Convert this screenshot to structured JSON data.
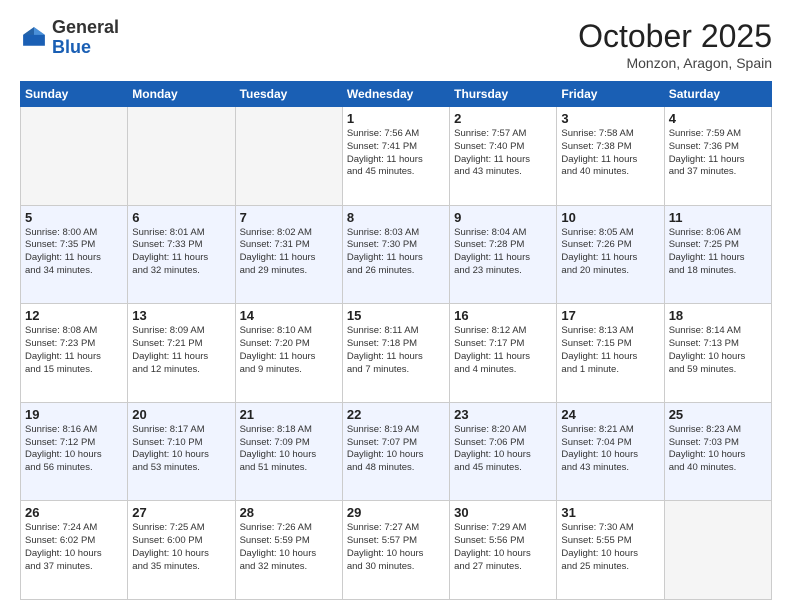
{
  "header": {
    "logo_general": "General",
    "logo_blue": "Blue",
    "month_title": "October 2025",
    "location": "Monzon, Aragon, Spain"
  },
  "weekdays": [
    "Sunday",
    "Monday",
    "Tuesday",
    "Wednesday",
    "Thursday",
    "Friday",
    "Saturday"
  ],
  "weeks": [
    [
      {
        "day": "",
        "info": ""
      },
      {
        "day": "",
        "info": ""
      },
      {
        "day": "",
        "info": ""
      },
      {
        "day": "1",
        "info": "Sunrise: 7:56 AM\nSunset: 7:41 PM\nDaylight: 11 hours\nand 45 minutes."
      },
      {
        "day": "2",
        "info": "Sunrise: 7:57 AM\nSunset: 7:40 PM\nDaylight: 11 hours\nand 43 minutes."
      },
      {
        "day": "3",
        "info": "Sunrise: 7:58 AM\nSunset: 7:38 PM\nDaylight: 11 hours\nand 40 minutes."
      },
      {
        "day": "4",
        "info": "Sunrise: 7:59 AM\nSunset: 7:36 PM\nDaylight: 11 hours\nand 37 minutes."
      }
    ],
    [
      {
        "day": "5",
        "info": "Sunrise: 8:00 AM\nSunset: 7:35 PM\nDaylight: 11 hours\nand 34 minutes."
      },
      {
        "day": "6",
        "info": "Sunrise: 8:01 AM\nSunset: 7:33 PM\nDaylight: 11 hours\nand 32 minutes."
      },
      {
        "day": "7",
        "info": "Sunrise: 8:02 AM\nSunset: 7:31 PM\nDaylight: 11 hours\nand 29 minutes."
      },
      {
        "day": "8",
        "info": "Sunrise: 8:03 AM\nSunset: 7:30 PM\nDaylight: 11 hours\nand 26 minutes."
      },
      {
        "day": "9",
        "info": "Sunrise: 8:04 AM\nSunset: 7:28 PM\nDaylight: 11 hours\nand 23 minutes."
      },
      {
        "day": "10",
        "info": "Sunrise: 8:05 AM\nSunset: 7:26 PM\nDaylight: 11 hours\nand 20 minutes."
      },
      {
        "day": "11",
        "info": "Sunrise: 8:06 AM\nSunset: 7:25 PM\nDaylight: 11 hours\nand 18 minutes."
      }
    ],
    [
      {
        "day": "12",
        "info": "Sunrise: 8:08 AM\nSunset: 7:23 PM\nDaylight: 11 hours\nand 15 minutes."
      },
      {
        "day": "13",
        "info": "Sunrise: 8:09 AM\nSunset: 7:21 PM\nDaylight: 11 hours\nand 12 minutes."
      },
      {
        "day": "14",
        "info": "Sunrise: 8:10 AM\nSunset: 7:20 PM\nDaylight: 11 hours\nand 9 minutes."
      },
      {
        "day": "15",
        "info": "Sunrise: 8:11 AM\nSunset: 7:18 PM\nDaylight: 11 hours\nand 7 minutes."
      },
      {
        "day": "16",
        "info": "Sunrise: 8:12 AM\nSunset: 7:17 PM\nDaylight: 11 hours\nand 4 minutes."
      },
      {
        "day": "17",
        "info": "Sunrise: 8:13 AM\nSunset: 7:15 PM\nDaylight: 11 hours\nand 1 minute."
      },
      {
        "day": "18",
        "info": "Sunrise: 8:14 AM\nSunset: 7:13 PM\nDaylight: 10 hours\nand 59 minutes."
      }
    ],
    [
      {
        "day": "19",
        "info": "Sunrise: 8:16 AM\nSunset: 7:12 PM\nDaylight: 10 hours\nand 56 minutes."
      },
      {
        "day": "20",
        "info": "Sunrise: 8:17 AM\nSunset: 7:10 PM\nDaylight: 10 hours\nand 53 minutes."
      },
      {
        "day": "21",
        "info": "Sunrise: 8:18 AM\nSunset: 7:09 PM\nDaylight: 10 hours\nand 51 minutes."
      },
      {
        "day": "22",
        "info": "Sunrise: 8:19 AM\nSunset: 7:07 PM\nDaylight: 10 hours\nand 48 minutes."
      },
      {
        "day": "23",
        "info": "Sunrise: 8:20 AM\nSunset: 7:06 PM\nDaylight: 10 hours\nand 45 minutes."
      },
      {
        "day": "24",
        "info": "Sunrise: 8:21 AM\nSunset: 7:04 PM\nDaylight: 10 hours\nand 43 minutes."
      },
      {
        "day": "25",
        "info": "Sunrise: 8:23 AM\nSunset: 7:03 PM\nDaylight: 10 hours\nand 40 minutes."
      }
    ],
    [
      {
        "day": "26",
        "info": "Sunrise: 7:24 AM\nSunset: 6:02 PM\nDaylight: 10 hours\nand 37 minutes."
      },
      {
        "day": "27",
        "info": "Sunrise: 7:25 AM\nSunset: 6:00 PM\nDaylight: 10 hours\nand 35 minutes."
      },
      {
        "day": "28",
        "info": "Sunrise: 7:26 AM\nSunset: 5:59 PM\nDaylight: 10 hours\nand 32 minutes."
      },
      {
        "day": "29",
        "info": "Sunrise: 7:27 AM\nSunset: 5:57 PM\nDaylight: 10 hours\nand 30 minutes."
      },
      {
        "day": "30",
        "info": "Sunrise: 7:29 AM\nSunset: 5:56 PM\nDaylight: 10 hours\nand 27 minutes."
      },
      {
        "day": "31",
        "info": "Sunrise: 7:30 AM\nSunset: 5:55 PM\nDaylight: 10 hours\nand 25 minutes."
      },
      {
        "day": "",
        "info": ""
      }
    ]
  ]
}
